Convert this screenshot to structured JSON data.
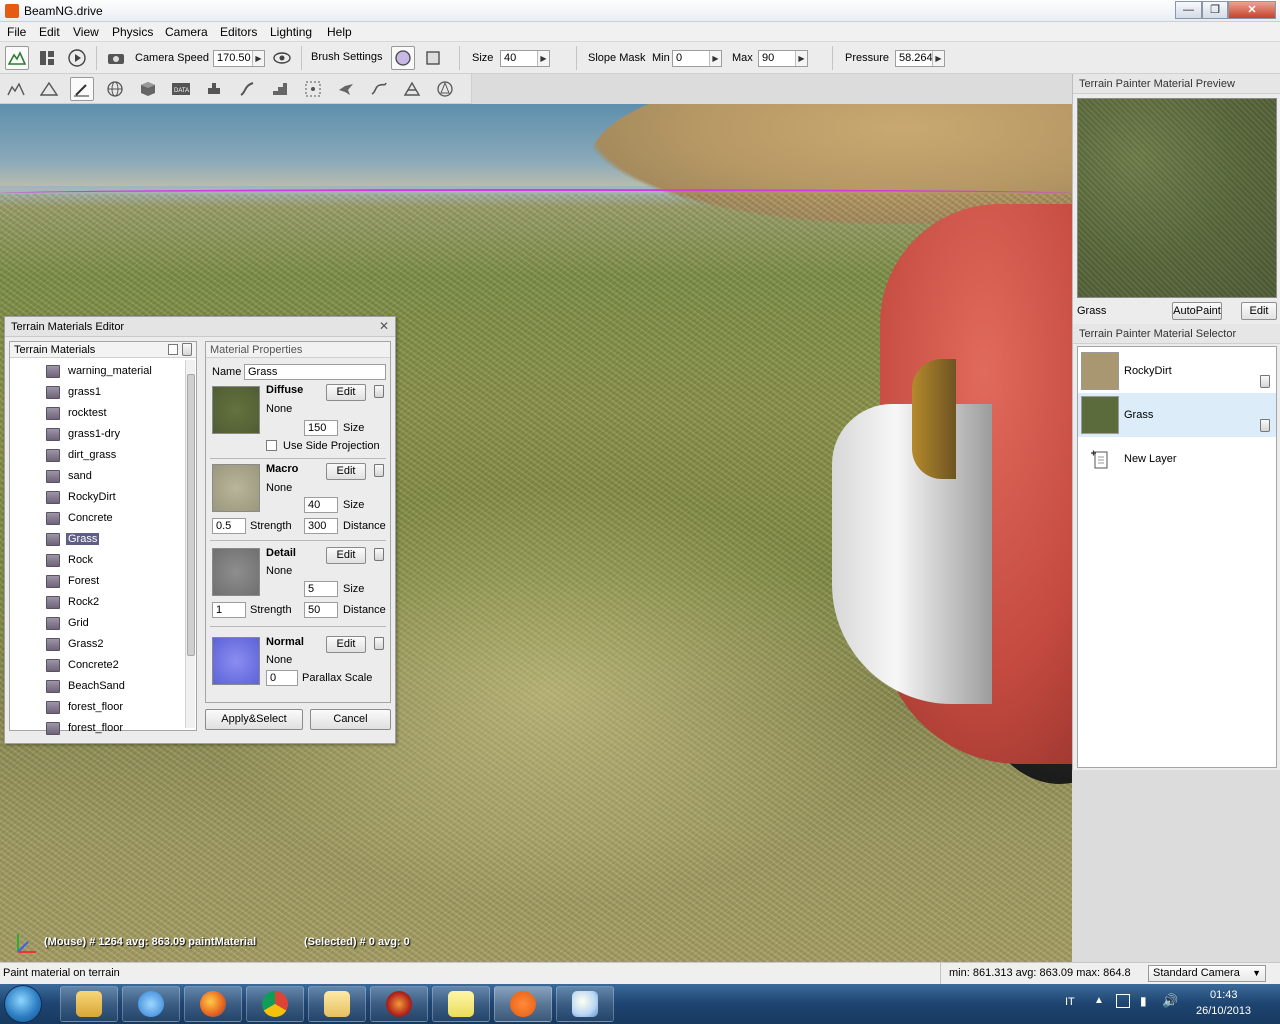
{
  "window": {
    "title": "BeamNG.drive",
    "min_glyph": "—",
    "max_glyph": "❐",
    "close_glyph": "✕"
  },
  "menu": [
    "File",
    "Edit",
    "View",
    "Physics",
    "Camera",
    "Editors",
    "Lighting",
    "Help"
  ],
  "toolbar1": {
    "camera_speed_label": "Camera Speed",
    "camera_speed_value": "170.50",
    "brush_settings_label": "Brush Settings",
    "size_label": "Size",
    "size_value": "40",
    "slope_mask_label": "Slope Mask",
    "min_label": "Min",
    "min_value": "0",
    "max_label": "Max",
    "max_value": "90",
    "pressure_label": "Pressure",
    "pressure_value": "58.264"
  },
  "toolbar2_icons": [
    "terrain-edit-icon",
    "triangle-icon",
    "paint-brush-icon",
    "globe-icon",
    "cube-icon",
    "data-icon",
    "road-icon",
    "river-icon",
    "stairs-icon",
    "select-box-icon",
    "bird-icon",
    "crumbs-icon",
    "mesh-icon",
    "star-shape-icon"
  ],
  "viewport": {
    "hud_mouse": "(Mouse) # 1264  avg: 863.09 paintMaterial",
    "hud_selected": "(Selected) # 0  avg: 0"
  },
  "preview_panel": {
    "header": "Terrain Painter Material Preview",
    "material": "Grass",
    "autopaint_button": "AutoPaint",
    "edit_button": "Edit"
  },
  "selector_panel": {
    "header": "Terrain Painter Material Selector",
    "layers": [
      {
        "name": "RockyDirt",
        "color": "#a89770"
      },
      {
        "name": "Grass",
        "color": "#5c6b3c"
      }
    ],
    "new_layer": "New Layer"
  },
  "editor": {
    "title": "Terrain Materials Editor",
    "close_glyph": "✕",
    "list_header": "Terrain Materials",
    "materials": [
      "warning_material",
      "grass1",
      "rocktest",
      "grass1-dry",
      "dirt_grass",
      "sand",
      "RockyDirt",
      "Concrete",
      "Grass",
      "Rock",
      "Forest",
      "Rock2",
      "Grid",
      "Grass2",
      "Concrete2",
      "BeachSand",
      "forest_floor",
      "forest_floor"
    ],
    "selected_index": 8,
    "props_header": "Material Properties",
    "name_label": "Name",
    "name_value": "Grass",
    "diffuse": {
      "title": "Diffuse",
      "edit": "Edit",
      "file": "None",
      "size_value": "150",
      "size_label": "Size",
      "side_projection": "Use Side Projection"
    },
    "macro": {
      "title": "Macro",
      "edit": "Edit",
      "file": "None",
      "size_value": "40",
      "size_label": "Size",
      "strength_value": "0.5",
      "strength_label": "Strength",
      "distance_value": "300",
      "distance_label": "Distance"
    },
    "detail": {
      "title": "Detail",
      "edit": "Edit",
      "file": "None",
      "size_value": "5",
      "size_label": "Size",
      "strength_value": "1",
      "strength_label": "Strength",
      "distance_value": "50",
      "distance_label": "Distance"
    },
    "normal": {
      "title": "Normal",
      "edit": "Edit",
      "file": "None",
      "parallax_value": "0",
      "parallax_label": "Parallax Scale"
    },
    "apply_button": "Apply&Select",
    "cancel_button": "Cancel"
  },
  "statusbar": {
    "hint": "Paint material on terrain",
    "stats": "min: 861.313  avg: 863.09  max: 864.8",
    "camera": "Standard Camera"
  },
  "taskbar": {
    "lang": "IT",
    "time": "01:43",
    "date": "26/10/2013"
  },
  "colors": {
    "accent_selection": "#5f5f86",
    "layer_selected": "#dcecf8",
    "magenta_line": "#d33be0"
  }
}
